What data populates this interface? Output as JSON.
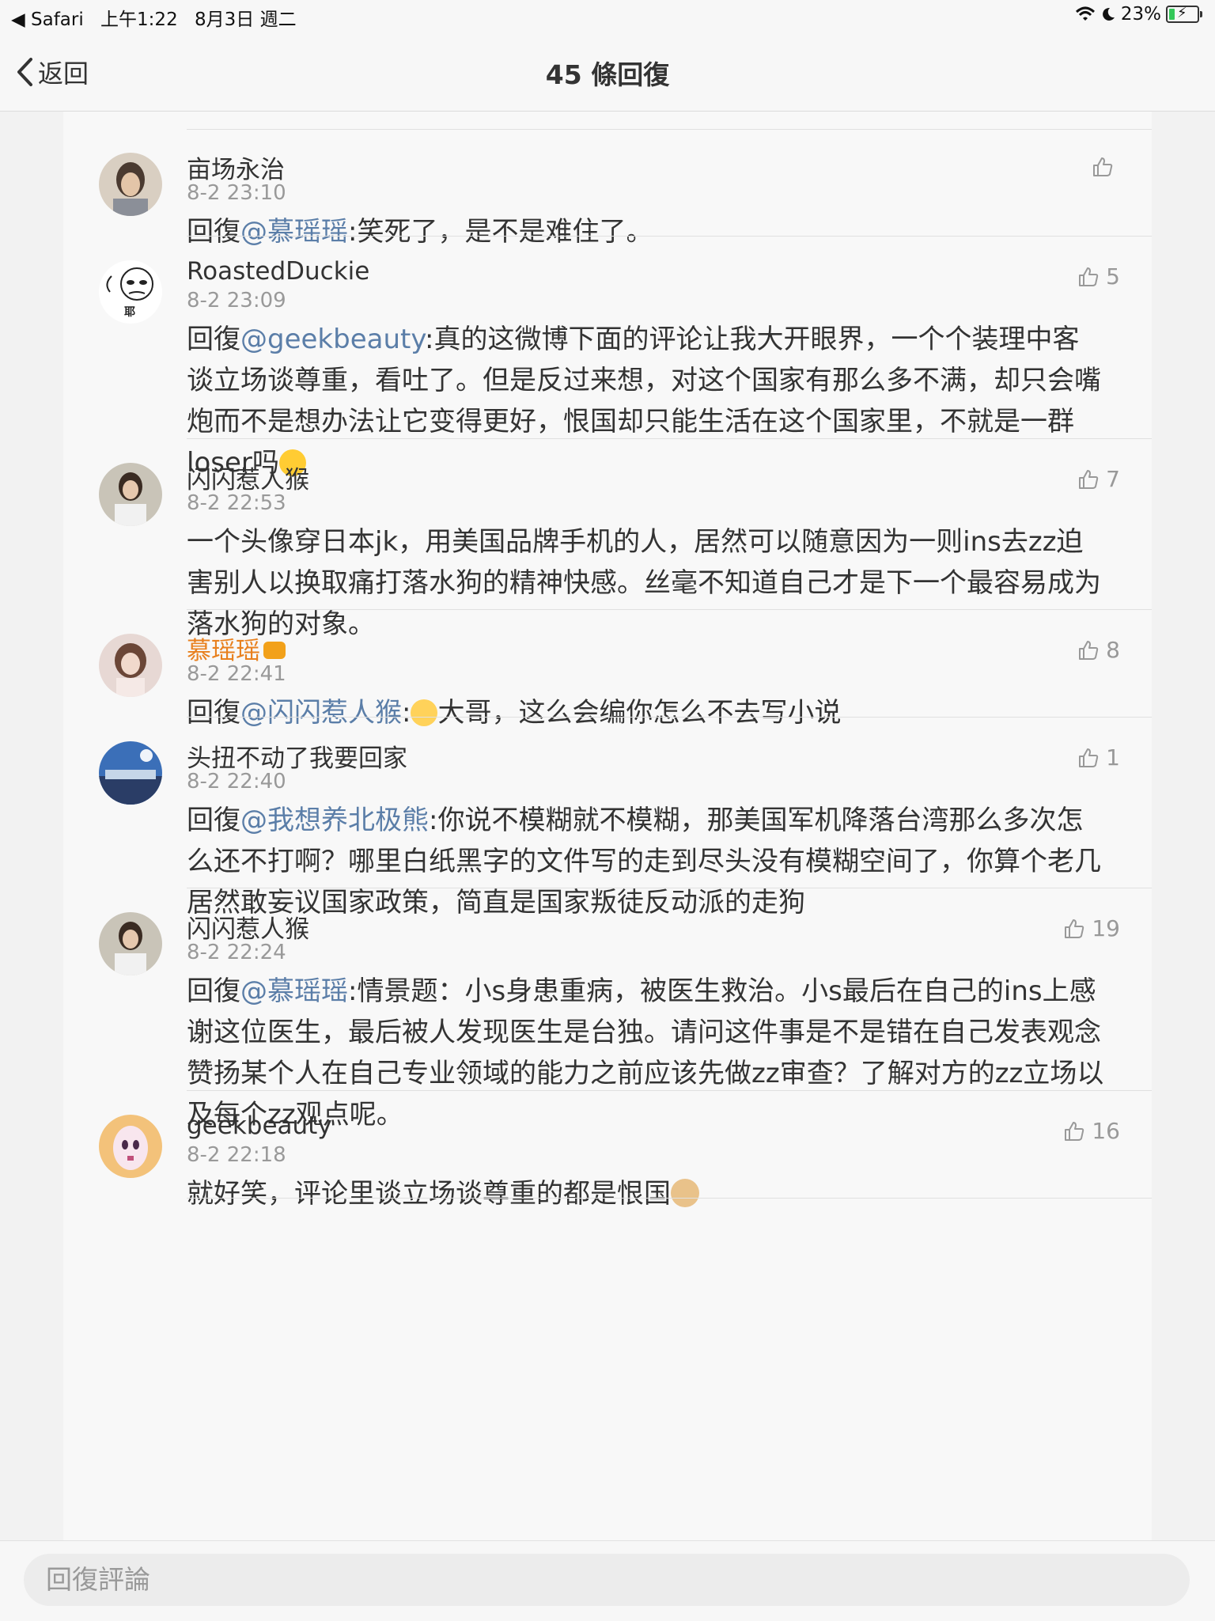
{
  "status_bar": {
    "back_app": "◀ Safari",
    "time": "上午1:22",
    "date": "8月3日 週二",
    "battery": "23%",
    "battery_level": 0.23
  },
  "nav": {
    "back_label": "返回",
    "title": "45 條回復"
  },
  "comments": [
    {
      "name": "亩场永治",
      "time": "8-2 23:10",
      "likes": "",
      "reply_prefix": "回復",
      "mention": "@慕瑶瑶",
      "text": ":笑死了，是不是难住了。"
    },
    {
      "name": "RoastedDuckie",
      "time": "8-2 23:09",
      "likes": "5",
      "reply_prefix": "回復",
      "mention": "@geekbeauty",
      "text": ":真的这微博下面的评论让我大开眼界，一个个装理中客谈立场谈尊重，看吐了。但是反过来想，对这个国家有那么多不满，却只会嘴炮而不是想办法让它变得更好，恨国却只能生活在这个国家里，不就是一群loser吗",
      "avatar_text": "耶"
    },
    {
      "name": "闪闪惹人猴",
      "time": "8-2 22:53",
      "likes": "7",
      "text": "一个头像穿日本jk，用美国品牌手机的人，居然可以随意因为一则ins去zz迫害别人以换取痛打落水狗的精神快感。丝毫不知道自己才是下一个最容易成为落水狗的对象。"
    },
    {
      "name": "慕瑶瑶",
      "time": "8-2 22:41",
      "likes": "8",
      "reply_prefix": "回復",
      "mention": "@闪闪惹人猴",
      "text_before": ":",
      "text": "大哥，这么会编你怎么不去写小说"
    },
    {
      "name": "头扭不动了我要回家",
      "time": "8-2 22:40",
      "likes": "1",
      "reply_prefix": "回復",
      "mention": "@我想养北极熊",
      "text": ":你说不模糊就不模糊，那美国军机降落台湾那么多次怎么还不打啊？哪里白纸黑字的文件写的走到尽头没有模糊空间了，你算个老几居然敢妄议国家政策，简直是国家叛徒反动派的走狗"
    },
    {
      "name": "闪闪惹人猴",
      "time": "8-2 22:24",
      "likes": "19",
      "reply_prefix": "回復",
      "mention": "@慕瑶瑶",
      "text": ":情景题：小s身患重病，被医生救治。小s最后在自己的ins上感谢这位医生，最后被人发现医生是台独。请问这件事是不是错在自己发表观念赞扬某个人在自己专业领域的能力之前应该先做zz审查？了解对方的zz立场以及每个zz观点呢。"
    },
    {
      "name": "geekbeauty",
      "time": "8-2 22:18",
      "likes": "16",
      "text": "就好笑，评论里谈立场谈尊重的都是恨国"
    }
  ],
  "reply_bar": {
    "placeholder": "回復評論"
  },
  "colors": {
    "mention": "#5b7ea8",
    "vip_name": "#e8801e",
    "muted": "#999999"
  },
  "icons": [
    "back-chevron-icon",
    "wifi-icon",
    "moon-icon",
    "battery-icon",
    "thumbs-up-icon",
    "laughing-emoji-icon",
    "shocked-emoji-icon",
    "dog-emoji-icon",
    "vip-badge-icon"
  ]
}
